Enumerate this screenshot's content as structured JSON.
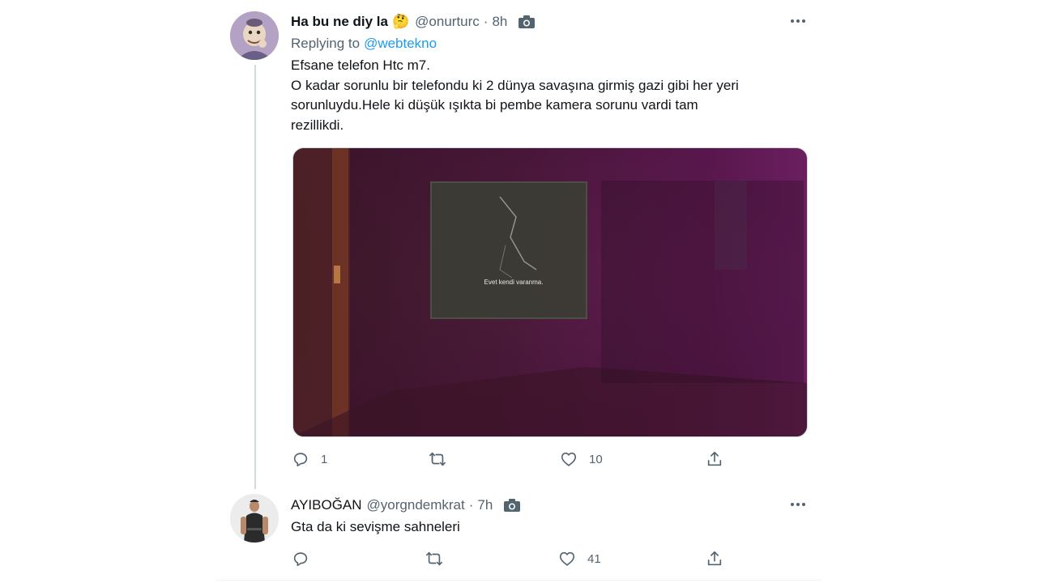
{
  "tweet1": {
    "display_name": "Ha bu ne diy la",
    "name_emoji": "🤔",
    "handle": "@onurturc",
    "sep": "·",
    "time": "8h",
    "replying_prefix": "Replying to",
    "replying_handle": "@webtekno",
    "text_lines": [
      "Efsane telefon Htc m7.",
      "O kadar sorunlu bir telefondu ki 2 dünya savaşına girmiş gazi gibi her yeri",
      "sorunluydu.Hele ki düşük ışıkta  bi pembe kamera sorunu vardi tam",
      "rezillikdi."
    ],
    "media_caption": "Evet kendi varanma.",
    "reply_count": "1",
    "like_count": "10"
  },
  "tweet2": {
    "display_name": "AYIBOĞAN",
    "handle": "@yorgndemkrat",
    "sep": "·",
    "time": "7h",
    "text": "Gta da ki sevişme sahneleri",
    "like_count": "41"
  },
  "colors": {
    "text": "#0f1419",
    "secondary": "#536471",
    "link": "#1d9bf0",
    "thread_line": "#cfd9de"
  },
  "icons": [
    "camera-icon",
    "more-icon",
    "reply-icon",
    "retweet-icon",
    "like-icon",
    "share-icon",
    "thinking-emoji"
  ]
}
